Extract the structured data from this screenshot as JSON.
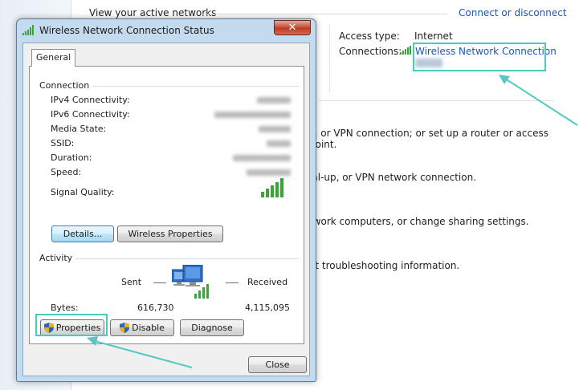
{
  "window": {
    "title": "Wireless Network Connection Status",
    "close_glyph": "✕"
  },
  "tabs": [
    {
      "label": "General"
    }
  ],
  "connection": {
    "group_label": "Connection",
    "rows": [
      {
        "label": "IPv4 Connectivity:"
      },
      {
        "label": "IPv6 Connectivity:"
      },
      {
        "label": "Media State:"
      },
      {
        "label": "SSID:"
      },
      {
        "label": "Duration:"
      },
      {
        "label": "Speed:"
      }
    ],
    "signal_label": "Signal Quality:",
    "details_button": "Details...",
    "wireless_properties_button": "Wireless Properties"
  },
  "activity": {
    "group_label": "Activity",
    "sent_label": "Sent",
    "received_label": "Received",
    "bytes_label": "Bytes:",
    "bytes_sent": "616,730",
    "bytes_received": "4,115,095"
  },
  "buttons": {
    "properties": "Properties",
    "disable": "Disable",
    "diagnose": "Diagnose",
    "close": "Close"
  },
  "background": {
    "heading": "View your active networks",
    "connect_link": "Connect or disconnect",
    "access_type_label": "Access type:",
    "access_type_value": "Internet",
    "connections_label": "Connections:",
    "connection_link": "Wireless Network Connection",
    "lines": [
      "c, or VPN connection; or set up a router or access point.",
      "ial-up, or VPN network connection.",
      "twork computers, or change sharing settings.",
      "et troubleshooting information."
    ]
  },
  "colors": {
    "highlight": "#4cc9c3",
    "link": "#1a58b8",
    "signal": "#3aa537"
  },
  "icons": {
    "window_icon": "wireless-signal-icon",
    "activity_icon": "network-computers-icon",
    "shield": "uac-shield-icon"
  }
}
